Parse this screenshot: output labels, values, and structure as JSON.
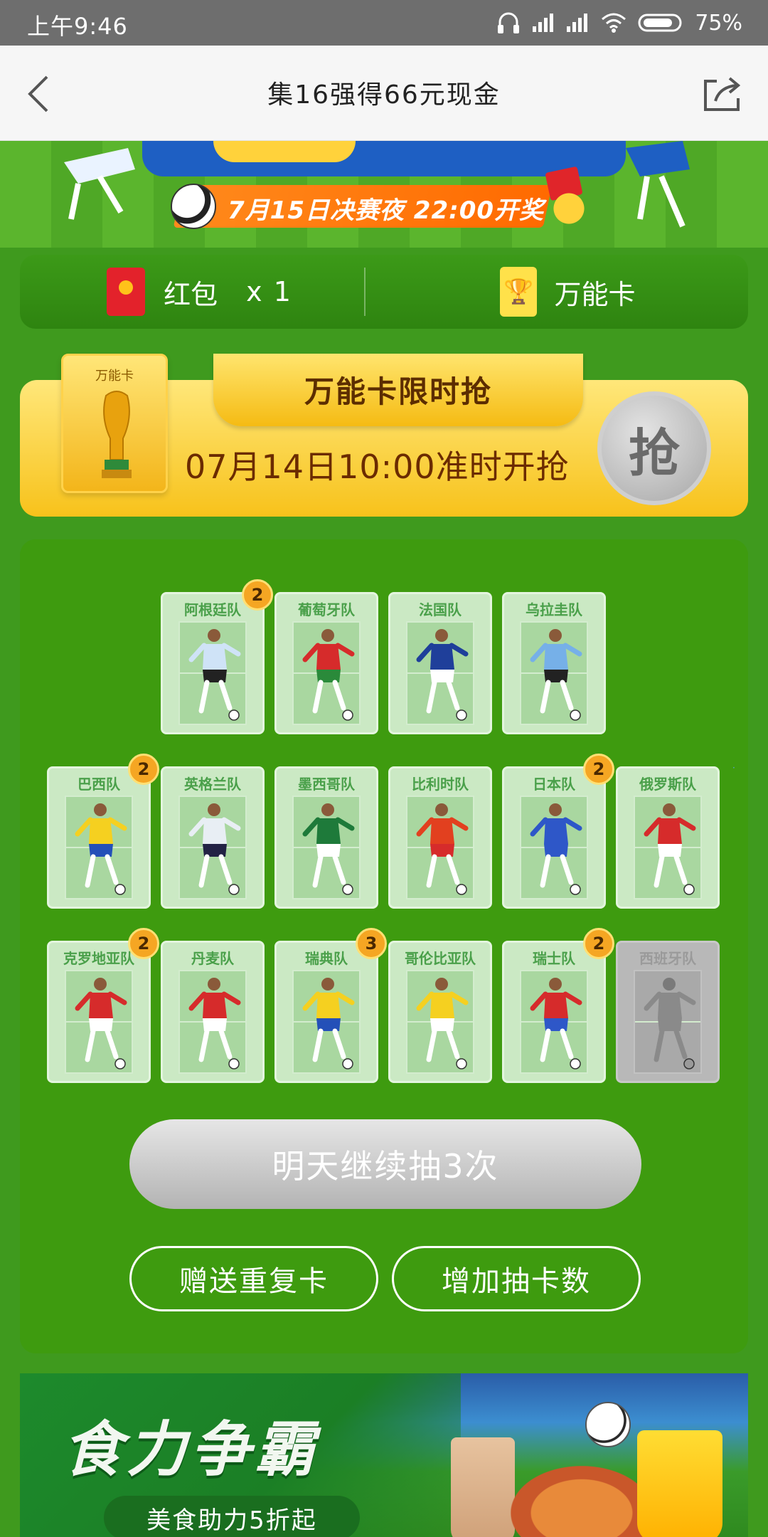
{
  "status_bar": {
    "time": "上午9:46",
    "battery": "75%"
  },
  "nav": {
    "title": "集16强得66元现金"
  },
  "hero": {
    "ribbon_text": "7月15日决赛夜 22:00开奖"
  },
  "stats": {
    "red_packet_label": "红包",
    "red_packet_count": "x 1",
    "wild_card_label": "万能卡"
  },
  "flash_sale": {
    "card_label": "万能卡",
    "title": "万能卡限时抢",
    "time_text": "07月14日10:00准时开抢",
    "grab_label": "抢"
  },
  "teams": [
    {
      "name": "阿根廷队",
      "count": "2",
      "shirt": "#cfe3f7",
      "shorts": "#222222",
      "owned": true
    },
    {
      "name": "葡萄牙队",
      "count": "",
      "shirt": "#d62b2b",
      "shorts": "#2a8a3a",
      "owned": true
    },
    {
      "name": "法国队",
      "count": "",
      "shirt": "#1f3f9a",
      "shorts": "#ffffff",
      "owned": true
    },
    {
      "name": "乌拉圭队",
      "count": "",
      "shirt": "#76b0e8",
      "shorts": "#222222",
      "owned": true
    },
    {
      "name": "巴西队",
      "count": "2",
      "shirt": "#f5d020",
      "shorts": "#2450b8",
      "owned": true
    },
    {
      "name": "英格兰队",
      "count": "",
      "shirt": "#e8eef4",
      "shorts": "#222244",
      "owned": true
    },
    {
      "name": "墨西哥队",
      "count": "",
      "shirt": "#1e7a3a",
      "shorts": "#ffffff",
      "owned": true
    },
    {
      "name": "比利时队",
      "count": "",
      "shirt": "#e2401f",
      "shorts": "#d62b2b",
      "owned": true
    },
    {
      "name": "日本队",
      "count": "2",
      "shirt": "#2e57c8",
      "shorts": "#2e57c8",
      "owned": true
    },
    {
      "name": "俄罗斯队",
      "count": "",
      "shirt": "#d62b2b",
      "shorts": "#ffffff",
      "owned": true
    },
    {
      "name": "克罗地亚队",
      "count": "2",
      "shirt": "#d62b2b",
      "shorts": "#ffffff",
      "owned": true
    },
    {
      "name": "丹麦队",
      "count": "",
      "shirt": "#d62b2b",
      "shorts": "#ffffff",
      "owned": true
    },
    {
      "name": "瑞典队",
      "count": "3",
      "shirt": "#f5d020",
      "shorts": "#2450b8",
      "owned": true
    },
    {
      "name": "哥伦比亚队",
      "count": "",
      "shirt": "#f5d020",
      "shorts": "#ffffff",
      "owned": true
    },
    {
      "name": "瑞士队",
      "count": "2",
      "shirt": "#d62b2b",
      "shorts": "#2e57c8",
      "owned": true
    },
    {
      "name": "西班牙队",
      "count": "",
      "shirt": "#8a8a8a",
      "shorts": "#8a8a8a",
      "owned": false
    }
  ],
  "actions": {
    "draw_label": "明天继续抽3次",
    "gift_label": "赠送重复卡",
    "add_draws_label": "增加抽卡数"
  },
  "ad": {
    "title": "食力争霸",
    "subtitle": "美食助力5折起"
  },
  "colors": {
    "panel_green": "#3e9b0f",
    "gold": "#f7c21b",
    "badge": "#f5a623"
  }
}
